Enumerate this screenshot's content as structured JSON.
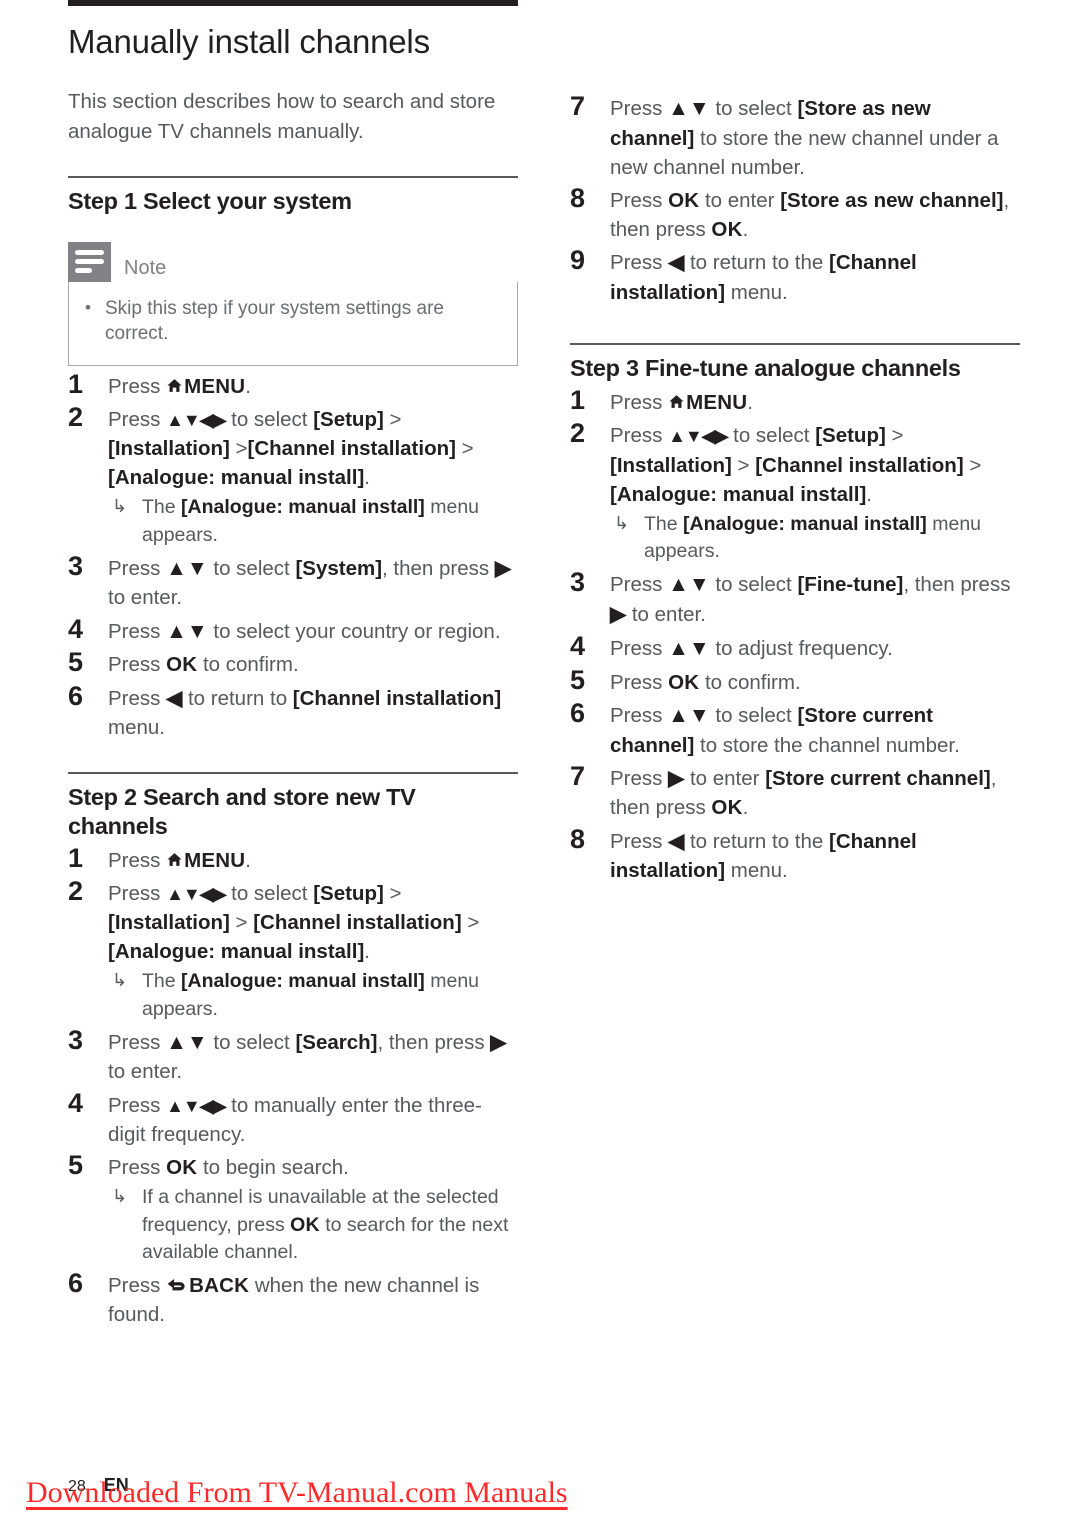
{
  "document": {
    "title": "Manually install channels",
    "intro": "This section describes how to search and store analogue TV channels manually."
  },
  "note": {
    "label": "Note",
    "bullet": "•",
    "text": "Skip this step if your system settings are correct."
  },
  "glyphs": {
    "home": "⌂",
    "back": "↰",
    "up_down": "▲▼",
    "up_down_left_right": "▲▼◀▶",
    "right": "▶",
    "left": "◀",
    "result_arrow": "↳"
  },
  "step1": {
    "heading": "Step 1 Select your system",
    "items": [
      {
        "num": "1",
        "parts": [
          {
            "t": "text",
            "v": "Press "
          },
          {
            "t": "home-icon"
          },
          {
            "t": "key",
            "v": "MENU"
          },
          {
            "t": "text",
            "v": "."
          }
        ]
      },
      {
        "num": "2",
        "parts": [
          {
            "t": "text",
            "v": "Press "
          },
          {
            "t": "glyph",
            "v": "▲▼◀▶"
          },
          {
            "t": "text",
            "v": " to select "
          },
          {
            "t": "bold",
            "v": "[Setup]"
          },
          {
            "t": "text",
            "v": " > "
          },
          {
            "t": "bold",
            "v": "[Installation]"
          },
          {
            "t": "text",
            "v": " >"
          },
          {
            "t": "bold",
            "v": "[Channel installation]"
          },
          {
            "t": "text",
            "v": " >"
          },
          {
            "t": "bold",
            "v": "[Analogue: manual install]"
          },
          {
            "t": "text",
            "v": "."
          }
        ],
        "result": [
          {
            "t": "text",
            "v": "The "
          },
          {
            "t": "bold",
            "v": "[Analogue: manual install]"
          },
          {
            "t": "text",
            "v": " menu appears."
          }
        ]
      },
      {
        "num": "3",
        "parts": [
          {
            "t": "text",
            "v": "Press "
          },
          {
            "t": "glyph",
            "v": "▲▼"
          },
          {
            "t": "text",
            "v": " to select "
          },
          {
            "t": "bold",
            "v": "[System]"
          },
          {
            "t": "text",
            "v": ", then press "
          },
          {
            "t": "glyph",
            "v": "▶"
          },
          {
            "t": "text",
            "v": " to enter."
          }
        ]
      },
      {
        "num": "4",
        "parts": [
          {
            "t": "text",
            "v": "Press "
          },
          {
            "t": "glyph",
            "v": "▲▼"
          },
          {
            "t": "text",
            "v": " to select your country or region."
          }
        ]
      },
      {
        "num": "5",
        "parts": [
          {
            "t": "text",
            "v": "Press "
          },
          {
            "t": "key",
            "v": "OK"
          },
          {
            "t": "text",
            "v": " to confirm."
          }
        ]
      },
      {
        "num": "6",
        "parts": [
          {
            "t": "text",
            "v": "Press "
          },
          {
            "t": "glyph",
            "v": "◀"
          },
          {
            "t": "text",
            "v": " to return to "
          },
          {
            "t": "bold",
            "v": "[Channel installation]"
          },
          {
            "t": "text",
            "v": " menu."
          }
        ]
      }
    ]
  },
  "step2": {
    "heading": "Step 2 Search and store new TV channels",
    "items": [
      {
        "num": "1",
        "parts": [
          {
            "t": "text",
            "v": "Press "
          },
          {
            "t": "home-icon"
          },
          {
            "t": "key",
            "v": "MENU"
          },
          {
            "t": "text",
            "v": "."
          }
        ]
      },
      {
        "num": "2",
        "parts": [
          {
            "t": "text",
            "v": "Press "
          },
          {
            "t": "glyph",
            "v": "▲▼◀▶"
          },
          {
            "t": "text",
            "v": " to select "
          },
          {
            "t": "bold",
            "v": "[Setup]"
          },
          {
            "t": "text",
            "v": " > "
          },
          {
            "t": "bold",
            "v": "[Installation]"
          },
          {
            "t": "text",
            "v": " > "
          },
          {
            "t": "bold",
            "v": "[Channel installation]"
          },
          {
            "t": "text",
            "v": " > "
          },
          {
            "t": "bold",
            "v": "[Analogue: manual install]"
          },
          {
            "t": "text",
            "v": "."
          }
        ],
        "result": [
          {
            "t": "text",
            "v": "The "
          },
          {
            "t": "bold",
            "v": "[Analogue: manual install]"
          },
          {
            "t": "text",
            "v": " menu appears."
          }
        ]
      },
      {
        "num": "3",
        "parts": [
          {
            "t": "text",
            "v": "Press "
          },
          {
            "t": "glyph",
            "v": "▲▼"
          },
          {
            "t": "text",
            "v": " to select "
          },
          {
            "t": "bold",
            "v": "[Search]"
          },
          {
            "t": "text",
            "v": ", then press "
          },
          {
            "t": "glyph",
            "v": "▶"
          },
          {
            "t": "text",
            "v": " to enter."
          }
        ]
      },
      {
        "num": "4",
        "parts": [
          {
            "t": "text",
            "v": "Press "
          },
          {
            "t": "glyph",
            "v": "▲▼◀▶"
          },
          {
            "t": "text",
            "v": " to manually enter the three-digit frequency."
          }
        ]
      },
      {
        "num": "5",
        "parts": [
          {
            "t": "text",
            "v": "Press "
          },
          {
            "t": "key",
            "v": "OK"
          },
          {
            "t": "text",
            "v": " to begin search."
          }
        ],
        "result": [
          {
            "t": "text",
            "v": "If a channel is unavailable at the selected frequency, press "
          },
          {
            "t": "key",
            "v": "OK"
          },
          {
            "t": "text",
            "v": " to search for the next available channel."
          }
        ]
      },
      {
        "num": "6",
        "parts": [
          {
            "t": "text",
            "v": "Press "
          },
          {
            "t": "back-icon"
          },
          {
            "t": "key",
            "v": "BACK"
          },
          {
            "t": "text",
            "v": " when the new channel is found."
          }
        ]
      }
    ]
  },
  "step2_continued": {
    "items": [
      {
        "num": "7",
        "parts": [
          {
            "t": "text",
            "v": "Press "
          },
          {
            "t": "glyph",
            "v": "▲▼"
          },
          {
            "t": "text",
            "v": " to select "
          },
          {
            "t": "bold",
            "v": "[Store as new channel]"
          },
          {
            "t": "text",
            "v": " to store the new channel under a new channel number."
          }
        ]
      },
      {
        "num": "8",
        "parts": [
          {
            "t": "text",
            "v": "Press "
          },
          {
            "t": "key",
            "v": "OK"
          },
          {
            "t": "text",
            "v": " to enter "
          },
          {
            "t": "bold",
            "v": "[Store as new channel]"
          },
          {
            "t": "text",
            "v": ", then press "
          },
          {
            "t": "key",
            "v": "OK"
          },
          {
            "t": "text",
            "v": "."
          }
        ]
      },
      {
        "num": "9",
        "parts": [
          {
            "t": "text",
            "v": "Press "
          },
          {
            "t": "glyph",
            "v": "◀"
          },
          {
            "t": "text",
            "v": " to return to the "
          },
          {
            "t": "bold",
            "v": "[Channel installation]"
          },
          {
            "t": "text",
            "v": " menu."
          }
        ]
      }
    ]
  },
  "step3": {
    "heading": "Step 3 Fine-tune analogue channels",
    "items": [
      {
        "num": "1",
        "parts": [
          {
            "t": "text",
            "v": "Press "
          },
          {
            "t": "home-icon"
          },
          {
            "t": "key",
            "v": "MENU"
          },
          {
            "t": "text",
            "v": "."
          }
        ]
      },
      {
        "num": "2",
        "parts": [
          {
            "t": "text",
            "v": "Press "
          },
          {
            "t": "glyph",
            "v": "▲▼◀▶"
          },
          {
            "t": "text",
            "v": " to select "
          },
          {
            "t": "bold",
            "v": "[Setup]"
          },
          {
            "t": "text",
            "v": " > "
          },
          {
            "t": "bold",
            "v": "[Installation]"
          },
          {
            "t": "text",
            "v": " > "
          },
          {
            "t": "bold",
            "v": "[Channel installation]"
          },
          {
            "t": "text",
            "v": " > "
          },
          {
            "t": "bold",
            "v": "[Analogue: manual install]"
          },
          {
            "t": "text",
            "v": "."
          }
        ],
        "result": [
          {
            "t": "text",
            "v": "The "
          },
          {
            "t": "bold",
            "v": "[Analogue: manual install]"
          },
          {
            "t": "text",
            "v": " menu appears."
          }
        ]
      },
      {
        "num": "3",
        "parts": [
          {
            "t": "text",
            "v": "Press "
          },
          {
            "t": "glyph",
            "v": "▲▼"
          },
          {
            "t": "text",
            "v": " to select "
          },
          {
            "t": "bold",
            "v": "[Fine-tune]"
          },
          {
            "t": "text",
            "v": ", then press "
          },
          {
            "t": "glyph",
            "v": "▶"
          },
          {
            "t": "text",
            "v": " to enter."
          }
        ]
      },
      {
        "num": "4",
        "parts": [
          {
            "t": "text",
            "v": "Press "
          },
          {
            "t": "glyph",
            "v": "▲▼"
          },
          {
            "t": "text",
            "v": " to adjust frequency."
          }
        ]
      },
      {
        "num": "5",
        "parts": [
          {
            "t": "text",
            "v": "Press "
          },
          {
            "t": "key",
            "v": "OK"
          },
          {
            "t": "text",
            "v": " to confirm."
          }
        ]
      },
      {
        "num": "6",
        "parts": [
          {
            "t": "text",
            "v": "Press "
          },
          {
            "t": "glyph",
            "v": "▲▼"
          },
          {
            "t": "text",
            "v": " to select "
          },
          {
            "t": "bold",
            "v": "[Store current channel]"
          },
          {
            "t": "text",
            "v": " to store the channel number."
          }
        ]
      },
      {
        "num": "7",
        "parts": [
          {
            "t": "text",
            "v": "Press "
          },
          {
            "t": "glyph",
            "v": "▶"
          },
          {
            "t": "text",
            "v": " to enter "
          },
          {
            "t": "bold",
            "v": "[Store current channel]"
          },
          {
            "t": "text",
            "v": ", then press "
          },
          {
            "t": "key",
            "v": "OK"
          },
          {
            "t": "text",
            "v": "."
          }
        ]
      },
      {
        "num": "8",
        "parts": [
          {
            "t": "text",
            "v": "Press "
          },
          {
            "t": "glyph",
            "v": "◀"
          },
          {
            "t": "text",
            "v": " to return to the "
          },
          {
            "t": "bold",
            "v": "[Channel installation]"
          },
          {
            "t": "text",
            "v": " menu."
          }
        ]
      }
    ]
  },
  "footer": {
    "page_number": "28",
    "language": "EN",
    "watermark": "Downloaded From TV-Manual.com Manuals",
    "watermark_color": "#ff2b2b"
  }
}
